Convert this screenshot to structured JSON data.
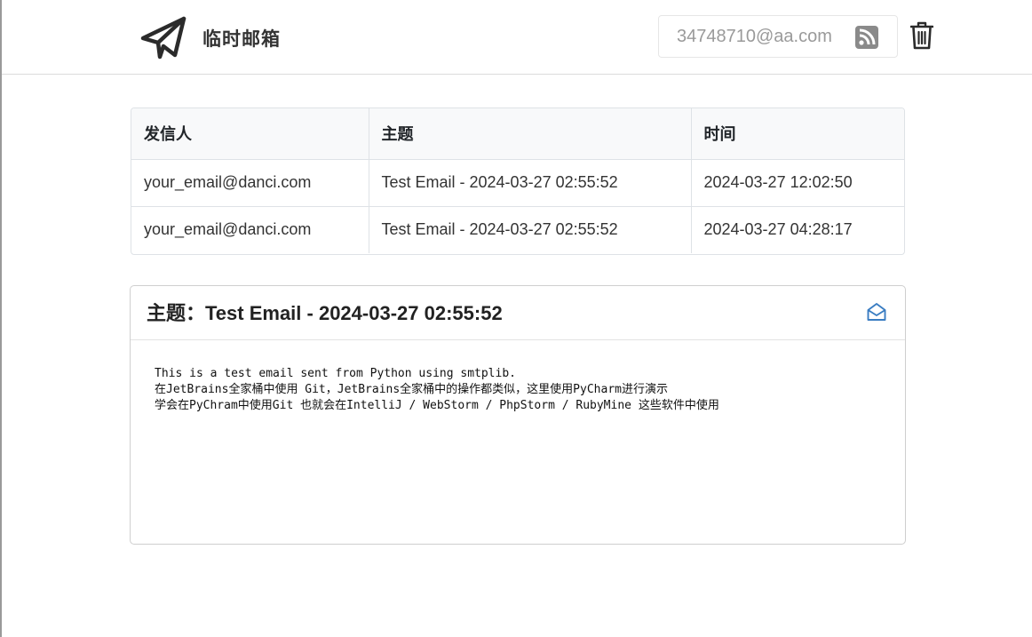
{
  "header": {
    "brand": "临时邮箱",
    "email_placeholder": "34748710@aa.com",
    "icons": {
      "logo": "paper-plane-icon",
      "rss": "rss-icon",
      "delete": "trash-icon"
    }
  },
  "table": {
    "columns": [
      "发信人",
      "主题",
      "时间"
    ],
    "rows": [
      {
        "from": "your_email@danci.com",
        "subject": "Test Email - 2024-03-27 02:55:52",
        "time": "2024-03-27 12:02:50"
      },
      {
        "from": "your_email@danci.com",
        "subject": "Test Email - 2024-03-27 02:55:52",
        "time": "2024-03-27 04:28:17"
      }
    ]
  },
  "detail": {
    "title": "主题：Test Email - 2024-03-27 02:55:52",
    "body_lines": [
      "This is a test email sent from Python using smtplib.",
      "在JetBrains全家桶中使用 Git，JetBrains全家桶中的操作都类似，这里使用PyCharm进行演示",
      "学会在PyChram中使用Git 也就会在IntelliJ / WebStorm / PhpStorm / RubyMine 这些软件中使用"
    ],
    "icons": {
      "opened": "envelope-open-icon"
    }
  },
  "colors": {
    "accent": "#3a7dc2",
    "border": "#dee2e6",
    "table_header_bg": "#f8f9fa"
  }
}
